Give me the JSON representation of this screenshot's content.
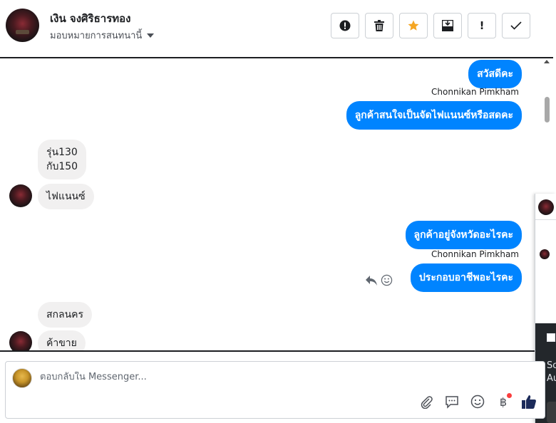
{
  "header": {
    "contact_name": "เงิน จงศิริธารทอง",
    "assign_label": "มอบหมายการสนทนานี้",
    "toolbar": {
      "spam": "!",
      "mark_done": "✓"
    }
  },
  "messages": [
    {
      "direction": "out",
      "text": "สวัสดีคะ"
    },
    {
      "direction": "out",
      "sender": "Chonnikan Pimkham",
      "text": "ลูกค้าสนใจเป็นจัดไฟแนนซ์หรือสดคะ"
    },
    {
      "direction": "in",
      "text_lines": [
        "รุ่น130",
        "กับ150"
      ]
    },
    {
      "direction": "in",
      "text": "ไฟแนนซ์"
    },
    {
      "direction": "out",
      "text": "ลูกค้าอยู่จังหวัดอะไรคะ"
    },
    {
      "direction": "out",
      "sender": "Chonnikan Pimkham",
      "text": "ประกอบอาชีพอะไรคะ"
    },
    {
      "direction": "in",
      "text": "สกลนคร"
    },
    {
      "direction": "in",
      "text": "ค้าขาย"
    }
  ],
  "side_panel": {
    "text_lines": [
      "So",
      "Au"
    ]
  },
  "composer": {
    "placeholder": "ตอบกลับใน Messenger...",
    "baht_symbol": "฿"
  },
  "colors": {
    "outgoing_bubble": "#0084ff",
    "incoming_bubble": "#f1f0f0",
    "star_accent": "#f5a623",
    "like_icon": "#1c2b5a"
  },
  "icons": [
    "alert-icon",
    "trash-icon",
    "star-icon",
    "archive-icon",
    "exclamation-icon",
    "check-icon",
    "reply-icon",
    "emoji-icon",
    "attach-icon",
    "saved-reply-icon",
    "baht-icon",
    "thumbs-up-icon"
  ]
}
